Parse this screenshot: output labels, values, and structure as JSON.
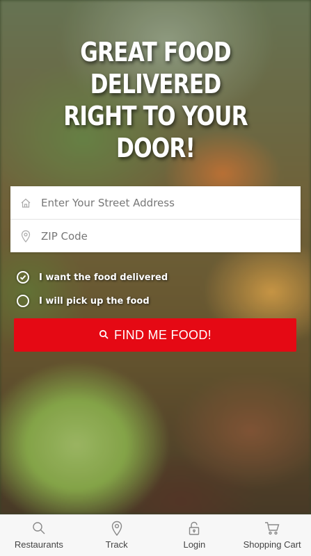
{
  "hero": {
    "headline_line1": "GREAT FOOD DELIVERED",
    "headline_line2": "RIGHT TO YOUR DOOR!"
  },
  "form": {
    "address": {
      "placeholder": "Enter Your Street Address",
      "value": "",
      "icon": "home-icon"
    },
    "zip": {
      "placeholder": "ZIP Code",
      "value": "",
      "icon": "location-pin-icon"
    }
  },
  "options": [
    {
      "label": "I want the food delivered",
      "selected": true
    },
    {
      "label": "I will pick up the food",
      "selected": false
    }
  ],
  "cta": {
    "label": "FIND ME FOOD!",
    "icon": "search-icon",
    "color": "#e50914"
  },
  "bottom_nav": [
    {
      "label": "Restaurants",
      "icon": "search-icon"
    },
    {
      "label": "Track",
      "icon": "location-pin-icon"
    },
    {
      "label": "Login",
      "icon": "lock-icon"
    },
    {
      "label": "Shopping Cart",
      "icon": "cart-icon"
    }
  ]
}
